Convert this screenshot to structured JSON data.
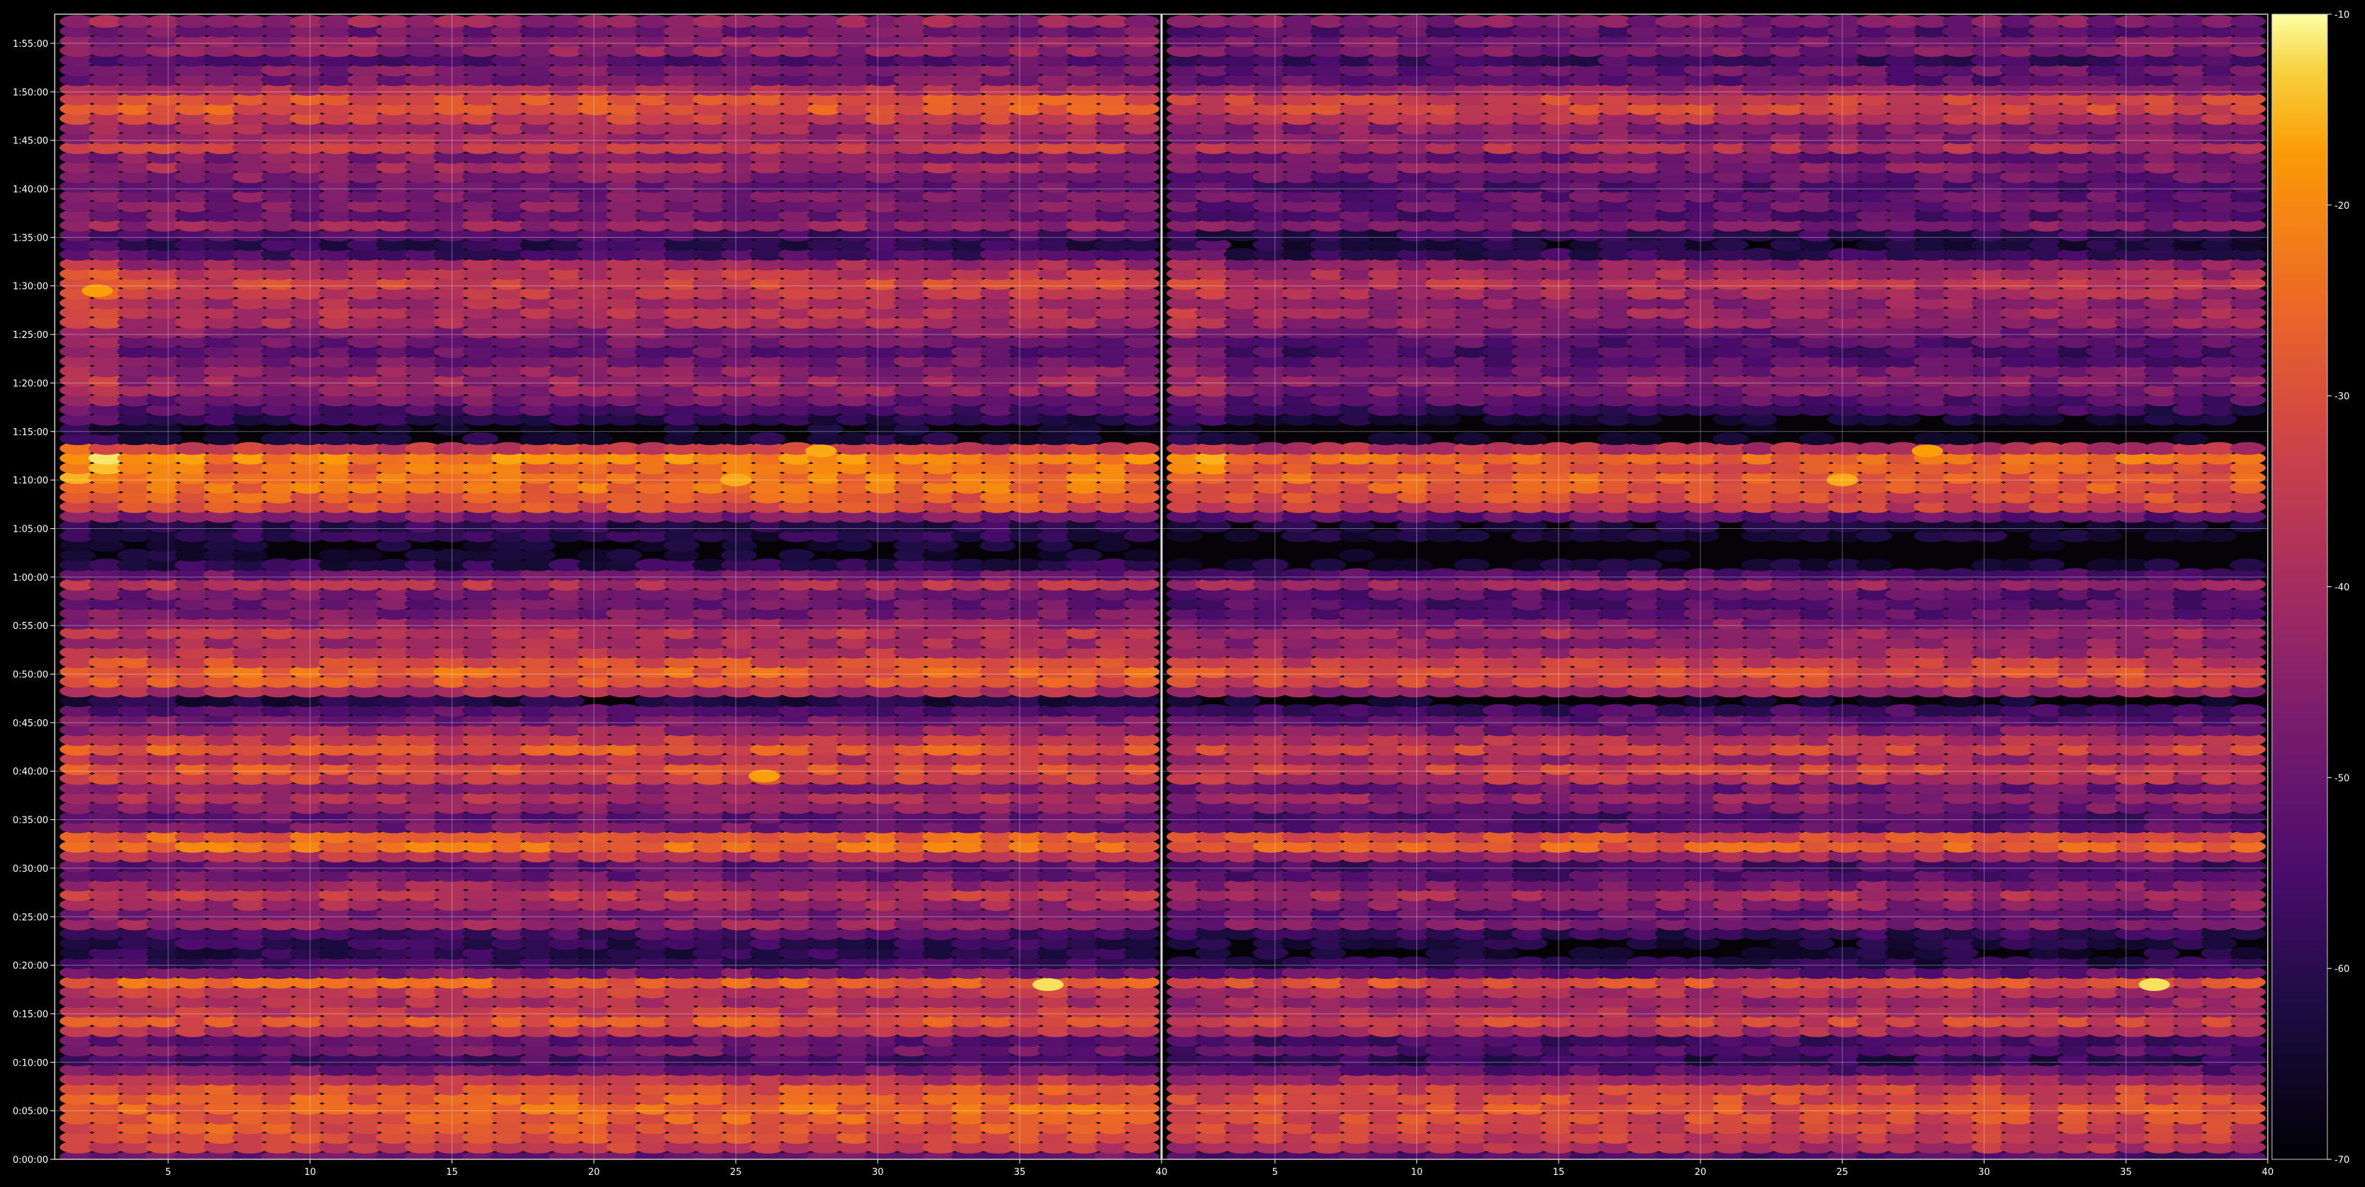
{
  "chart_data": {
    "type": "heatmap",
    "title": "",
    "xlabel": "",
    "ylabel": "",
    "panels": [
      {
        "name": "",
        "xlim": [
          1,
          40
        ],
        "x_ticks": [
          "5",
          "10",
          "15",
          "20",
          "25",
          "30",
          "35"
        ],
        "x_end_label": "40"
      },
      {
        "name": "",
        "xlim": [
          1,
          40
        ],
        "x_ticks": [
          "5",
          "10",
          "15",
          "20",
          "25",
          "30",
          "35"
        ],
        "x_end_label": "40"
      }
    ],
    "y_ticks": [
      "0:00:00",
      "0:05:00",
      "0:10:00",
      "0:15:00",
      "0:20:00",
      "0:25:00",
      "0:30:00",
      "0:35:00",
      "0:40:00",
      "0:45:00",
      "0:50:00",
      "0:55:00",
      "1:00:00",
      "1:05:00",
      "1:10:00",
      "1:15:00",
      "1:20:00",
      "1:25:00",
      "1:30:00",
      "1:35:00",
      "1:40:00",
      "1:45:00",
      "1:50:00",
      "1:55:00"
    ],
    "y_range_minutes": [
      0,
      118
    ],
    "grid": true,
    "colormap": "inferno",
    "colorbar": {
      "min": -70,
      "max": -10,
      "ticks": [
        "-10",
        "-20",
        "-30",
        "-40",
        "-50",
        "-60",
        "-70"
      ],
      "position": "right"
    },
    "row_profile_minutes_to_level": [
      [
        0.0,
        -55
      ],
      [
        1.0,
        -35
      ],
      [
        2.5,
        -30
      ],
      [
        4.0,
        -28
      ],
      [
        5.0,
        -25
      ],
      [
        6.0,
        -27
      ],
      [
        7.5,
        -30
      ],
      [
        9.0,
        -45
      ],
      [
        10.0,
        -60
      ],
      [
        10.8,
        -45
      ],
      [
        12.0,
        -55
      ],
      [
        13.5,
        -32
      ],
      [
        14.5,
        -28
      ],
      [
        15.5,
        -38
      ],
      [
        17.0,
        -40
      ],
      [
        18.0,
        -20
      ],
      [
        19.0,
        -45
      ],
      [
        20.0,
        -55
      ],
      [
        21.0,
        -60
      ],
      [
        23.0,
        -58
      ],
      [
        24.5,
        -40
      ],
      [
        25.5,
        -50
      ],
      [
        26.5,
        -38
      ],
      [
        27.5,
        -35
      ],
      [
        28.5,
        -45
      ],
      [
        30.0,
        -55
      ],
      [
        32.0,
        -25
      ],
      [
        33.0,
        -20
      ],
      [
        34.0,
        -48
      ],
      [
        35.5,
        -52
      ],
      [
        36.5,
        -42
      ],
      [
        37.5,
        -38
      ],
      [
        38.5,
        -48
      ],
      [
        39.5,
        -28
      ],
      [
        40.5,
        -30
      ],
      [
        41.5,
        -40
      ],
      [
        42.5,
        -25
      ],
      [
        43.5,
        -38
      ],
      [
        45.0,
        -48
      ],
      [
        46.0,
        -50
      ],
      [
        47.5,
        -65
      ],
      [
        48.5,
        -30
      ],
      [
        49.5,
        -28
      ],
      [
        50.5,
        -26
      ],
      [
        51.5,
        -32
      ],
      [
        53.0,
        -42
      ],
      [
        54.0,
        -35
      ],
      [
        55.5,
        -45
      ],
      [
        57.0,
        -50
      ],
      [
        58.5,
        -48
      ],
      [
        59.5,
        -35
      ],
      [
        60.5,
        -55
      ],
      [
        62.0,
        -65
      ],
      [
        63.0,
        -68
      ],
      [
        64.0,
        -60
      ],
      [
        65.0,
        -62
      ],
      [
        66.0,
        -52
      ],
      [
        67.0,
        -32
      ],
      [
        68.0,
        -28
      ],
      [
        69.0,
        -25
      ],
      [
        70.0,
        -22
      ],
      [
        71.0,
        -26
      ],
      [
        72.0,
        -20
      ],
      [
        73.0,
        -25
      ],
      [
        74.0,
        -62
      ],
      [
        75.0,
        -68
      ],
      [
        76.0,
        -62
      ],
      [
        77.0,
        -55
      ],
      [
        78.5,
        -48
      ],
      [
        79.5,
        -42
      ],
      [
        80.5,
        -42
      ],
      [
        82.0,
        -48
      ],
      [
        83.5,
        -52
      ],
      [
        84.5,
        -48
      ],
      [
        85.5,
        -45
      ],
      [
        86.5,
        -38
      ],
      [
        87.5,
        -38
      ],
      [
        88.5,
        -40
      ],
      [
        89.5,
        -35
      ],
      [
        90.5,
        -32
      ],
      [
        91.5,
        -38
      ],
      [
        92.5,
        -42
      ],
      [
        93.5,
        -60
      ],
      [
        95.0,
        -58
      ],
      [
        96.5,
        -40
      ],
      [
        97.5,
        -52
      ],
      [
        98.5,
        -45
      ],
      [
        99.5,
        -48
      ],
      [
        100.5,
        -50
      ],
      [
        101.5,
        -45
      ],
      [
        102.5,
        -40
      ],
      [
        103.5,
        -48
      ],
      [
        104.5,
        -30
      ],
      [
        105.5,
        -45
      ],
      [
        106.5,
        -40
      ],
      [
        107.5,
        -32
      ],
      [
        108.5,
        -28
      ],
      [
        109.5,
        -30
      ],
      [
        110.5,
        -42
      ],
      [
        111.5,
        -50
      ],
      [
        112.5,
        -45
      ],
      [
        113.5,
        -55
      ],
      [
        114.5,
        -40
      ],
      [
        115.5,
        -45
      ],
      [
        116.5,
        -50
      ],
      [
        117.5,
        -40
      ]
    ],
    "highlights": [
      {
        "panel": 0,
        "x": 2.5,
        "minute": 89.5,
        "level": -17
      },
      {
        "panel": 0,
        "x": 28,
        "minute": 73.0,
        "level": -16
      },
      {
        "panel": 0,
        "x": 25,
        "minute": 70.0,
        "level": -16
      },
      {
        "panel": 0,
        "x": 36,
        "minute": 18.0,
        "level": -12
      },
      {
        "panel": 0,
        "x": 26,
        "minute": 39.5,
        "level": -17
      },
      {
        "panel": 1,
        "x": 36,
        "minute": 18.0,
        "level": -12
      },
      {
        "panel": 1,
        "x": 25,
        "minute": 70.0,
        "level": -16
      },
      {
        "panel": 1,
        "x": 28,
        "minute": 73.0,
        "level": -17
      }
    ]
  }
}
